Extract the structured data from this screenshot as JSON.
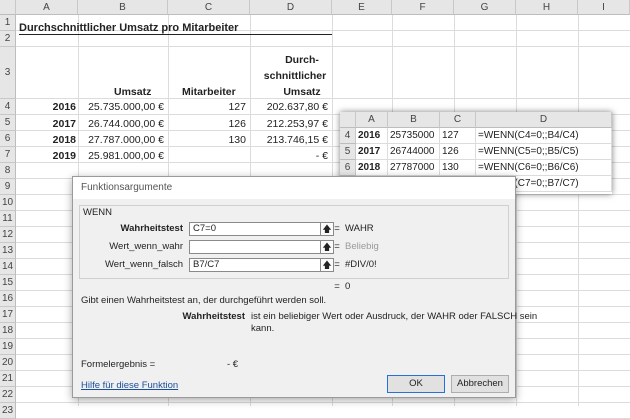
{
  "columns": [
    "A",
    "B",
    "C",
    "D",
    "E",
    "F",
    "G",
    "H",
    "I"
  ],
  "rows": [
    "1",
    "2",
    "3",
    "4",
    "5",
    "6",
    "7",
    "8",
    "9",
    "10",
    "11",
    "12",
    "13",
    "14",
    "15",
    "16",
    "17",
    "18",
    "19",
    "20",
    "21",
    "22",
    "23"
  ],
  "sheet": {
    "title": "Durchschnittlicher Umsatz pro Mitarbeiter",
    "header": {
      "umsatz": "Umsatz",
      "mitarbeiter": "Mitarbeiter",
      "durch1": "Durch-",
      "durch2": "schnittlicher",
      "durch3": "Umsatz"
    },
    "data": [
      {
        "year": "2016",
        "umsatz": "25.735.000,00 €",
        "ma": "127",
        "avg": "202.637,80 €"
      },
      {
        "year": "2017",
        "umsatz": "26.744.000,00 €",
        "ma": "126",
        "avg": "212.253,97 €"
      },
      {
        "year": "2018",
        "umsatz": "27.787.000,00 €",
        "ma": "130",
        "avg": "213.746,15 €"
      },
      {
        "year": "2019",
        "umsatz": "25.981.000,00 €",
        "ma": "",
        "avg": "-     €"
      }
    ]
  },
  "overlay": {
    "cols": [
      "A",
      "B",
      "C",
      "D"
    ],
    "rows": [
      {
        "n": "4",
        "a": "2016",
        "b": "25735000",
        "c": "127",
        "d": "=WENN(C4=0;;B4/C4)"
      },
      {
        "n": "5",
        "a": "2017",
        "b": "26744000",
        "c": "126",
        "d": "=WENN(C5=0;;B5/C5)"
      },
      {
        "n": "6",
        "a": "2018",
        "b": "27787000",
        "c": "130",
        "d": "=WENN(C6=0;;B6/C6)"
      },
      {
        "n": "7",
        "a": "2019",
        "b": "25981000",
        "c": "",
        "d": "=WENN(C7=0;;B7/C7)"
      }
    ]
  },
  "dialog": {
    "title": "Funktionsargumente",
    "function": "WENN",
    "arg1_label": "Wahrheitstest",
    "arg1_value": "C7=0",
    "arg1_result": "WAHR",
    "arg2_label": "Wert_wenn_wahr",
    "arg2_value": "",
    "arg2_result": "Beliebig",
    "arg3_label": "Wert_wenn_falsch",
    "arg3_value": "B7/C7",
    "arg3_result": "#DIV/0!",
    "eq_result": "0",
    "description": "Gibt einen Wahrheitstest an, der durchgeführt werden soll.",
    "param_name": "Wahrheitstest",
    "param_desc1": "ist ein beliebiger Wert oder Ausdruck, der WAHR oder FALSCH sein",
    "param_desc2": "kann.",
    "formula_label": "Formelergebnis =",
    "formula_value": "-   €",
    "help_link": "Hilfe für diese Funktion",
    "ok": "OK",
    "cancel": "Abbrechen",
    "equals": "="
  }
}
